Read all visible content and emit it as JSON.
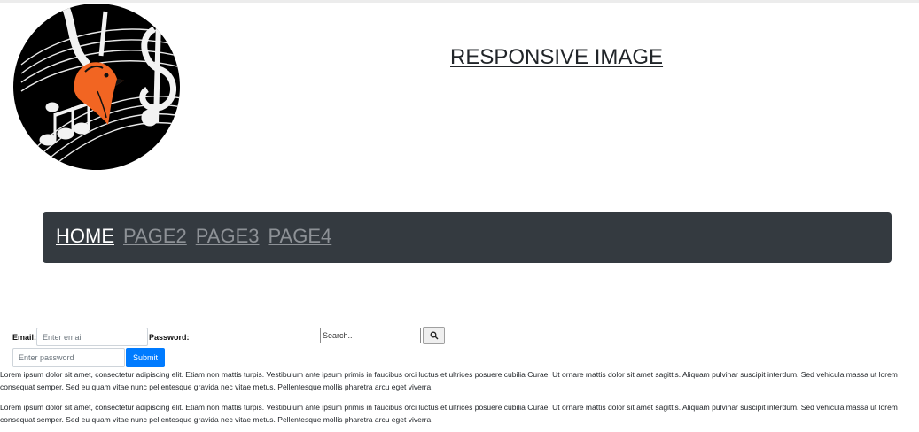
{
  "header": {
    "logo_alt": "music bird logo",
    "title": "RESPONSIVE IMAGE"
  },
  "nav": {
    "items": [
      {
        "label": "HOME",
        "active": true
      },
      {
        "label": "PAGE2",
        "active": false
      },
      {
        "label": "PAGE3",
        "active": false
      },
      {
        "label": "PAGE4",
        "active": false
      }
    ]
  },
  "login": {
    "email_label": "Email:",
    "email_placeholder": "Enter email",
    "password_label": "Password:",
    "password_placeholder": "Enter password",
    "submit_label": "Submit"
  },
  "search": {
    "placeholder": "Search..",
    "icon": "search-icon"
  },
  "content": {
    "paragraphs": [
      "Lorem ipsum dolor sit amet, consectetur adipiscing elit. Etiam non mattis turpis. Vestibulum ante ipsum primis in faucibus orci luctus et ultrices posuere cubilia Curae; Ut ornare mattis dolor sit amet sagittis. Aliquam pulvinar suscipit interdum. Sed vehicula massa ut lorem consequat semper. Sed eu quam vitae nunc pellentesque gravida nec vitae metus. Pellentesque mollis pharetra arcu eget viverra.",
      "Lorem ipsum dolor sit amet, consectetur adipiscing elit. Etiam non mattis turpis. Vestibulum ante ipsum primis in faucibus orci luctus et ultrices posuere cubilia Curae; Ut ornare mattis dolor sit amet sagittis. Aliquam pulvinar suscipit interdum. Sed vehicula massa ut lorem consequat semper. Sed eu quam vitae nunc pellentesque gravida nec vitae metus. Pellentesque mollis pharetra arcu eget viverra."
    ]
  },
  "colors": {
    "navbar_bg": "#343a40",
    "nav_active": "#ffffff",
    "nav_inactive": "#8d9196",
    "submit_bg": "#007bff",
    "logo_bird": "#f26522"
  }
}
